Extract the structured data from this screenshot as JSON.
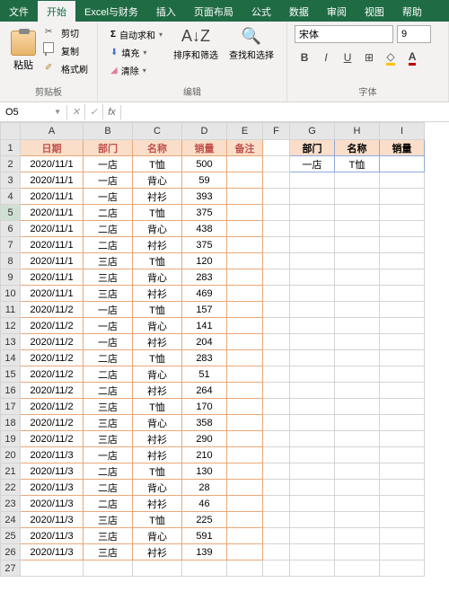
{
  "tabs": [
    "文件",
    "开始",
    "Excel与财务",
    "插入",
    "页面布局",
    "公式",
    "数据",
    "审阅",
    "视图",
    "帮助"
  ],
  "active_tab": 1,
  "ribbon": {
    "paste": "粘贴",
    "cut": "剪切",
    "copy": "复制",
    "format_painter": "格式刷",
    "clipboard": "剪贴板",
    "autosum": "自动求和",
    "fill": "填充",
    "clear": "清除",
    "editing": "编辑",
    "sort_filter": "排序和筛选",
    "find_select": "查找和选择",
    "font_group": "字体",
    "font_name": "宋体",
    "font_size": "9"
  },
  "namebox": "O5",
  "formula": "",
  "cols": [
    "A",
    "B",
    "C",
    "D",
    "E",
    "F",
    "G",
    "H",
    "I"
  ],
  "headers": [
    "日期",
    "部门",
    "名称",
    "销量",
    "备注"
  ],
  "headers2": [
    "部门",
    "名称",
    "销量"
  ],
  "rows": [
    [
      "2020/11/1",
      "一店",
      "T恤",
      "500",
      ""
    ],
    [
      "2020/11/1",
      "一店",
      "背心",
      "59",
      ""
    ],
    [
      "2020/11/1",
      "一店",
      "衬衫",
      "393",
      ""
    ],
    [
      "2020/11/1",
      "二店",
      "T恤",
      "375",
      ""
    ],
    [
      "2020/11/1",
      "二店",
      "背心",
      "438",
      ""
    ],
    [
      "2020/11/1",
      "二店",
      "衬衫",
      "375",
      ""
    ],
    [
      "2020/11/1",
      "三店",
      "T恤",
      "120",
      ""
    ],
    [
      "2020/11/1",
      "三店",
      "背心",
      "283",
      ""
    ],
    [
      "2020/11/1",
      "三店",
      "衬衫",
      "469",
      ""
    ],
    [
      "2020/11/2",
      "一店",
      "T恤",
      "157",
      ""
    ],
    [
      "2020/11/2",
      "一店",
      "背心",
      "141",
      ""
    ],
    [
      "2020/11/2",
      "一店",
      "衬衫",
      "204",
      ""
    ],
    [
      "2020/11/2",
      "二店",
      "T恤",
      "283",
      ""
    ],
    [
      "2020/11/2",
      "二店",
      "背心",
      "51",
      ""
    ],
    [
      "2020/11/2",
      "二店",
      "衬衫",
      "264",
      ""
    ],
    [
      "2020/11/2",
      "三店",
      "T恤",
      "170",
      ""
    ],
    [
      "2020/11/2",
      "三店",
      "背心",
      "358",
      ""
    ],
    [
      "2020/11/2",
      "三店",
      "衬衫",
      "290",
      ""
    ],
    [
      "2020/11/3",
      "一店",
      "衬衫",
      "210",
      ""
    ],
    [
      "2020/11/3",
      "二店",
      "T恤",
      "130",
      ""
    ],
    [
      "2020/11/3",
      "二店",
      "背心",
      "28",
      ""
    ],
    [
      "2020/11/3",
      "二店",
      "衬衫",
      "46",
      ""
    ],
    [
      "2020/11/3",
      "三店",
      "T恤",
      "225",
      ""
    ],
    [
      "2020/11/3",
      "三店",
      "背心",
      "591",
      ""
    ],
    [
      "2020/11/3",
      "三店",
      "衬衫",
      "139",
      ""
    ]
  ],
  "lookup": [
    "一店",
    "T恤",
    ""
  ],
  "selected_row": 5
}
